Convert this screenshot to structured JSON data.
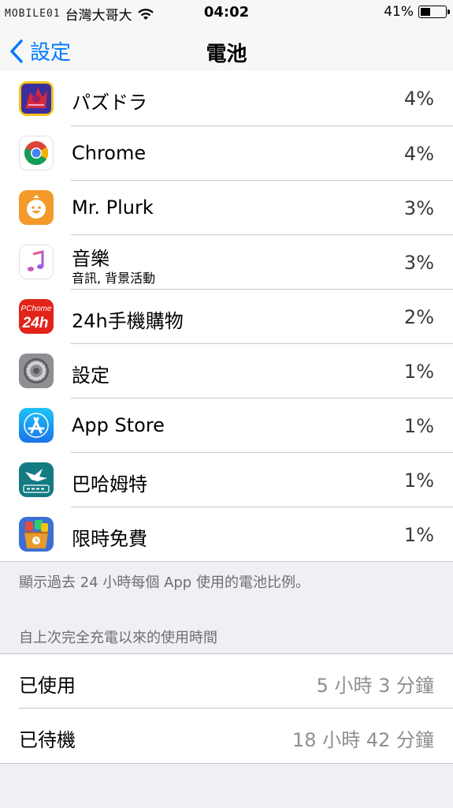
{
  "status_bar": {
    "watermark": "MOBILE01",
    "carrier": "台灣大哥大",
    "time": "04:02",
    "battery_percent_label": "41%",
    "battery_level": 0.41
  },
  "nav": {
    "back_label": "設定",
    "title": "電池"
  },
  "apps": [
    {
      "name": "パズドラ",
      "subtitle": "",
      "percent": "4%",
      "icon": "puzzle-and-dragons-icon"
    },
    {
      "name": "Chrome",
      "subtitle": "",
      "percent": "4%",
      "icon": "chrome-icon"
    },
    {
      "name": "Mr. Plurk",
      "subtitle": "",
      "percent": "3%",
      "icon": "plurk-icon"
    },
    {
      "name": "音樂",
      "subtitle": "音訊, 背景活動",
      "percent": "3%",
      "icon": "music-icon"
    },
    {
      "name": "24h手機購物",
      "subtitle": "",
      "percent": "2%",
      "icon": "pchome-24h-icon"
    },
    {
      "name": "設定",
      "subtitle": "",
      "percent": "1%",
      "icon": "settings-gear-icon"
    },
    {
      "name": "App Store",
      "subtitle": "",
      "percent": "1%",
      "icon": "app-store-icon"
    },
    {
      "name": "巴哈姆特",
      "subtitle": "",
      "percent": "1%",
      "icon": "bahamut-icon"
    },
    {
      "name": "限時免費",
      "subtitle": "",
      "percent": "1%",
      "icon": "free-apps-icon"
    }
  ],
  "footnote": "顯示過去 24 小時每個 App 使用的電池比例。",
  "usage_section": {
    "header": "自上次完全充電以來的使用時間",
    "rows": [
      {
        "label": "已使用",
        "value": "5 小時 3 分鐘"
      },
      {
        "label": "已待機",
        "value": "18 小時 42 分鐘"
      }
    ]
  },
  "colors": {
    "accent": "#007aff",
    "background": "#efeff4",
    "separator": "#c8c7cc",
    "secondary_text": "#8e8e93"
  }
}
